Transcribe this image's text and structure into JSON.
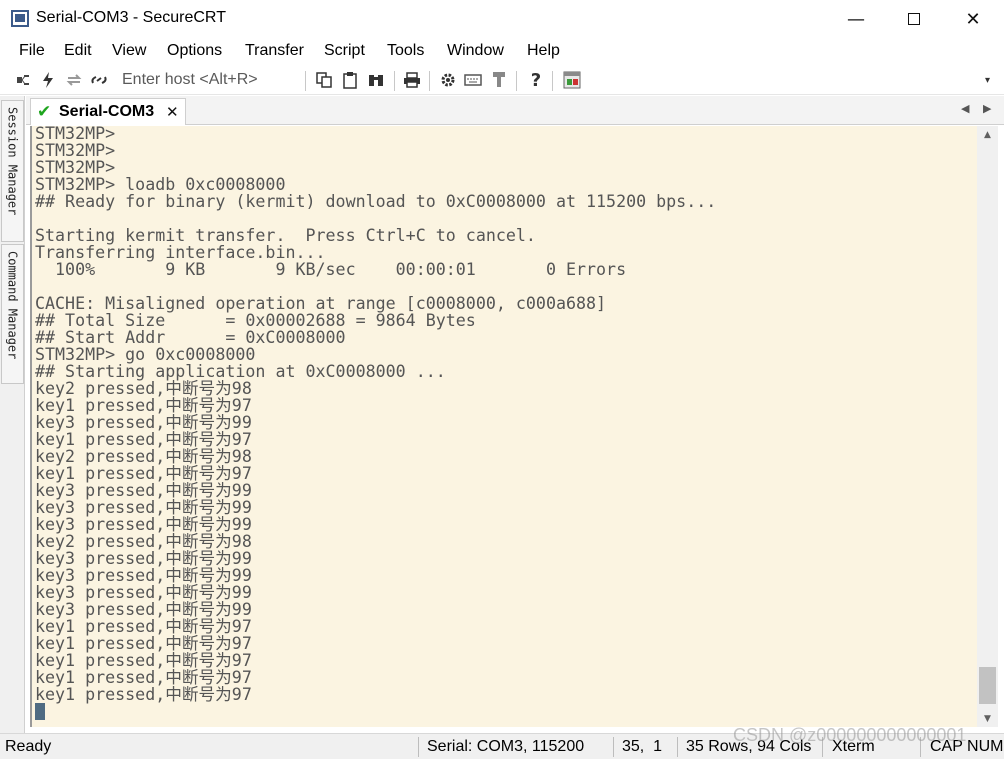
{
  "window": {
    "title": "Serial-COM3 - SecureCRT",
    "minimize_glyph": "—",
    "close_glyph": "✕"
  },
  "menu": {
    "items": [
      "File",
      "Edit",
      "View",
      "Options",
      "Transfer",
      "Script",
      "Tools",
      "Window",
      "Help"
    ]
  },
  "toolbar": {
    "host_placeholder": "Enter host <Alt+R>",
    "icons": [
      "connect-icon",
      "quick-connect-icon",
      "reconnect-icon",
      "disconnect-icon",
      "copy-icon",
      "paste-icon",
      "find-icon",
      "print-icon",
      "session-options-icon",
      "keymap-icon",
      "sftp-icon",
      "help-icon",
      "sessions-icon"
    ]
  },
  "sidepanel": {
    "session_manager": "Session Manager",
    "command_manager": "Command Manager"
  },
  "tabs": {
    "active_label": "Serial-COM3",
    "close_glyph": "✕",
    "prev_glyph": "◀",
    "next_glyph": "▶"
  },
  "terminal": {
    "lines": [
      "STM32MP>",
      "STM32MP>",
      "STM32MP>",
      "STM32MP> loadb 0xc0008000",
      "## Ready for binary (kermit) download to 0xC0008000 at 115200 bps...",
      "",
      "Starting kermit transfer.  Press Ctrl+C to cancel.",
      "Transferring interface.bin...",
      "  100%       9 KB       9 KB/sec    00:00:01       0 Errors",
      "",
      "CACHE: Misaligned operation at range [c0008000, c000a688]",
      "## Total Size      = 0x00002688 = 9864 Bytes",
      "## Start Addr      = 0xC0008000",
      "STM32MP> go 0xc0008000",
      "## Starting application at 0xC0008000 ...",
      "key2 pressed,中断号为98",
      "key1 pressed,中断号为97",
      "key3 pressed,中断号为99",
      "key1 pressed,中断号为97",
      "key2 pressed,中断号为98",
      "key1 pressed,中断号为97",
      "key3 pressed,中断号为99",
      "key3 pressed,中断号为99",
      "key3 pressed,中断号为99",
      "key2 pressed,中断号为98",
      "key3 pressed,中断号为99",
      "key3 pressed,中断号为99",
      "key3 pressed,中断号为99",
      "key3 pressed,中断号为99",
      "key1 pressed,中断号为97",
      "key1 pressed,中断号为97",
      "key1 pressed,中断号为97",
      "key1 pressed,中断号为97",
      "key1 pressed,中断号为97"
    ]
  },
  "statusbar": {
    "ready": "Ready",
    "connection": "Serial: COM3, 115200",
    "cursor_pos": "35,  1",
    "size": "35 Rows, 94 Cols",
    "emulation": "Xterm",
    "caps": "CAP NUM"
  },
  "watermark": "CSDN @z000000000000001",
  "colors": {
    "terminal_bg": "#fbf4e1",
    "terminal_fg": "#555555",
    "cursor": "#4f6b82",
    "check": "#1ea51e"
  }
}
